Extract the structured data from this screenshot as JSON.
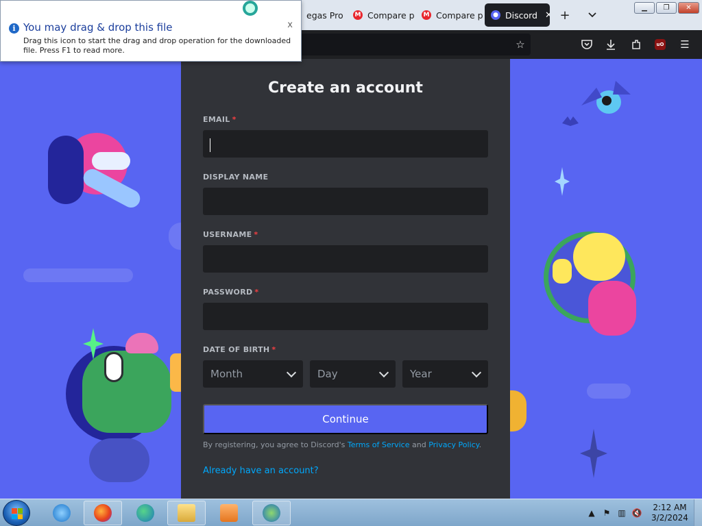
{
  "browser": {
    "tabs": [
      {
        "label": "egas Pro",
        "favicon": "mega-icon"
      },
      {
        "label": "Compare p",
        "favicon": "mega-icon"
      },
      {
        "label": "Compare p",
        "favicon": "mega-icon"
      },
      {
        "label": "Discord",
        "favicon": "discord-icon",
        "active": true
      }
    ],
    "new_tab": "+",
    "tab_list": "⌄"
  },
  "notification": {
    "title": "You may drag & drop this file",
    "body": "Drag this icon to start the drag and drop operation for the downloaded file. Press F1 to read more.",
    "close": "x"
  },
  "register": {
    "title": "Create an account",
    "email_label": "EMAIL",
    "display_name_label": "DISPLAY NAME",
    "username_label": "USERNAME",
    "password_label": "PASSWORD",
    "dob_label": "DATE OF BIRTH",
    "required_mark": "*",
    "email_value": "",
    "display_name_value": "",
    "username_value": "",
    "password_value": "",
    "month": "Month",
    "day": "Day",
    "year": "Year",
    "continue": "Continue",
    "legal_prefix": "By registering, you agree to Discord's ",
    "terms": "Terms of Service",
    "legal_and": " and ",
    "privacy": "Privacy Policy",
    "legal_suffix": ".",
    "login_link": "Already have an account?"
  },
  "taskbar": {
    "time": "2:12 AM",
    "date": "3/2/2024"
  },
  "colors": {
    "page_bg": "#5865f2",
    "card_bg": "#313338",
    "input_bg": "#1e1f22",
    "accent": "#5865f2",
    "link": "#00a8fc",
    "required": "#f23f42"
  }
}
